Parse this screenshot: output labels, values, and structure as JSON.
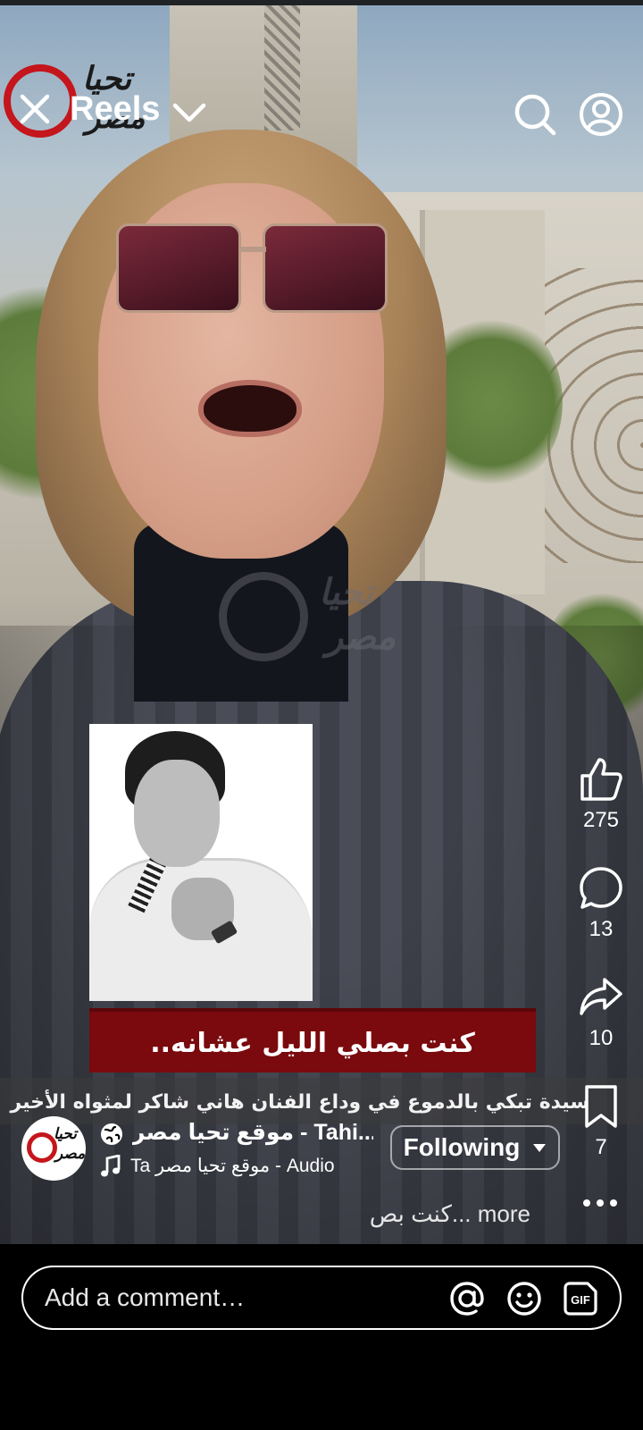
{
  "header": {
    "title": "Reels",
    "logo_text_top": "تحيا",
    "logo_text_bottom": "مصر",
    "icons": [
      "close-icon",
      "chevron-down-icon",
      "search-icon",
      "profile-icon"
    ]
  },
  "video": {
    "banner_text": "كنت بصلي الليل عشانه..",
    "caption_title": "سيدة تبكي بالدموع في وداع الفنان هاني شاكر لمثواه الأخير",
    "watermark_top": "تحيا",
    "watermark_bottom": "مصر"
  },
  "actions": {
    "likes": "275",
    "comments": "13",
    "shares": "10",
    "saves": "7",
    "icons": [
      "like-icon",
      "comment-icon",
      "share-icon",
      "save-icon",
      "more-icon"
    ]
  },
  "author": {
    "name": "موقع تحيا مصر - Tahi...",
    "audio": "Ta   موقع تحيا مصر - Audio",
    "following_label": "Following",
    "caption_preview": "كنت بص... more",
    "avatar_text_top": "تحيا",
    "avatar_text_bottom": "مصر"
  },
  "comment_bar": {
    "placeholder": "Add a comment…",
    "gif_label": "GIF"
  },
  "colors": {
    "banner_red": "#7a0a0d",
    "logo_red": "#c4161c",
    "background": "#000000",
    "text": "#ffffff"
  }
}
